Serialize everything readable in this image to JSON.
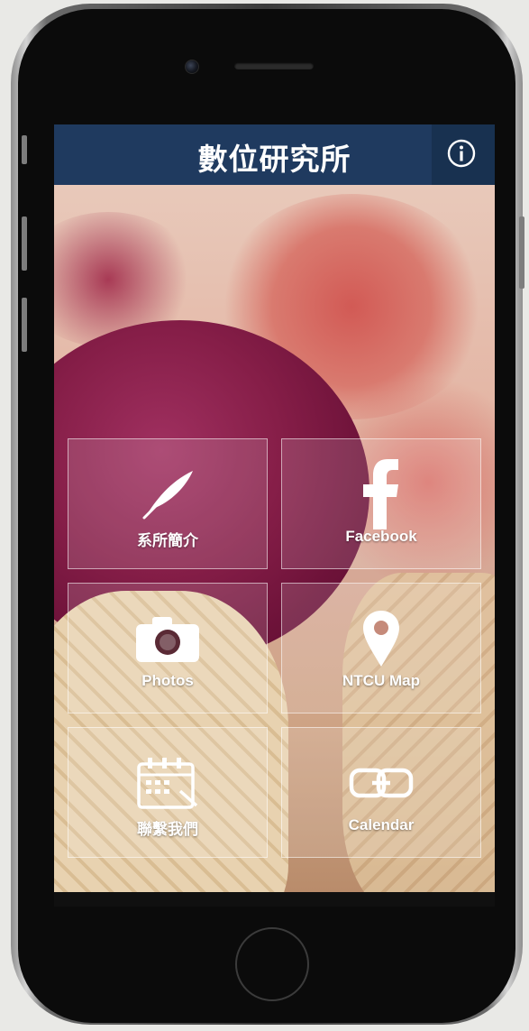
{
  "app": {
    "title": "數位研究所",
    "info_icon": "info-circle-icon"
  },
  "tiles": [
    {
      "label": "系所簡介",
      "icon": "feather-icon"
    },
    {
      "label": "Facebook",
      "icon": "facebook-icon"
    },
    {
      "label": "Photos",
      "icon": "camera-icon"
    },
    {
      "label": "NTCU Map",
      "icon": "map-pin-icon"
    },
    {
      "label": "聯繫我們",
      "icon": "calendar-icon"
    },
    {
      "label": "Calendar",
      "icon": "link-icon"
    }
  ],
  "colors": {
    "header": "#1f3a5f",
    "tile_border": "#ffffff",
    "text": "#ffffff"
  }
}
